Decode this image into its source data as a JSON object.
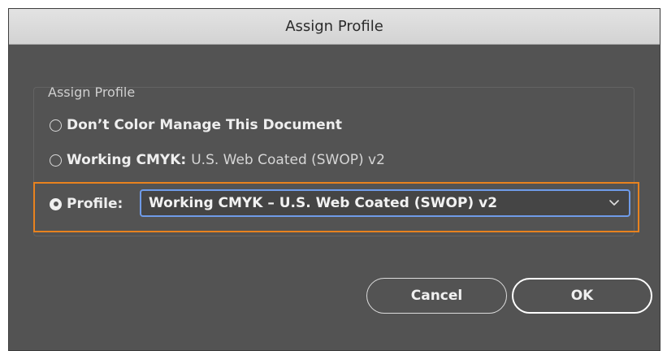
{
  "dialog": {
    "title": "Assign Profile",
    "group_label": "Assign Profile",
    "options": [
      {
        "label": "Don’t Color Manage This Document",
        "value": "",
        "checked": false
      },
      {
        "label": "Working CMYK:",
        "value": "U.S. Web Coated (SWOP) v2",
        "checked": false
      },
      {
        "label": "Profile:",
        "value": "",
        "checked": true
      }
    ],
    "profile_select": {
      "selected": "Working CMYK – U.S. Web Coated (SWOP) v2",
      "icon": "chevron-down-icon"
    },
    "buttons": {
      "cancel": "Cancel",
      "ok": "OK"
    }
  },
  "colors": {
    "background": "#535353",
    "focus_outline": "#e8821e",
    "select_focus": "#6f9be8"
  }
}
